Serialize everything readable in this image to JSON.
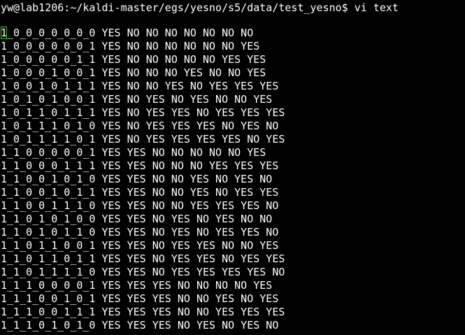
{
  "terminal": {
    "prompt": "yw@lab1206:~/kaldi-master/egs/yesno/s5/data/test_yesno$ vi text",
    "cursor_color": "#2fd02f",
    "lines": [
      "1_0_0_0_0_0_0_0 YES NO NO NO NO NO NO NO",
      "1_0_0_0_0_0_0_1 YES NO NO NO NO NO NO YES",
      "1_0_0_0_0_0_1_1 YES NO NO NO NO NO YES YES",
      "1_0_0_0_1_0_0_1 YES NO NO NO YES NO NO YES",
      "1_0_0_1_0_1_1_1 YES NO NO YES NO YES YES YES",
      "1_0_1_0_1_0_0_1 YES NO YES NO YES NO NO YES",
      "1_0_1_1_0_1_1_1 YES NO YES YES NO YES YES YES",
      "1_0_1_1_1_0_1_0 YES NO YES YES YES NO YES NO",
      "1_0_1_1_1_1_0_1 YES NO YES YES YES YES NO YES",
      "1_1_0_0_0_0_0_1 YES YES NO NO NO NO NO YES",
      "1_1_0_0_0_1_1_1 YES YES NO NO NO YES YES YES",
      "1_1_0_0_1_0_1_0 YES YES NO NO YES NO YES NO",
      "1_1_0_0_1_0_1_1 YES YES NO NO YES NO YES YES",
      "1_1_0_0_1_1_1_0 YES YES NO NO YES YES YES NO",
      "1_1_0_1_0_1_0_0 YES YES NO YES NO YES NO NO",
      "1_1_0_1_0_1_1_0 YES YES NO YES NO YES YES NO",
      "1_1_0_1_1_0_0_1 YES YES NO YES YES NO NO YES",
      "1_1_0_1_1_0_1_1 YES YES NO YES YES NO YES YES",
      "1_1_0_1_1_1_1_0 YES YES NO YES YES YES YES NO",
      "1_1_1_0_0_0_0_1 YES YES YES NO NO NO NO YES",
      "1_1_1_0_0_1_0_1 YES YES YES NO NO YES NO YES",
      "1_1_1_0_0_1_1_1 YES YES YES NO NO YES YES YES",
      "1_1_1_0_1_0_1_0 YES YES YES NO YES NO YES NO"
    ]
  }
}
